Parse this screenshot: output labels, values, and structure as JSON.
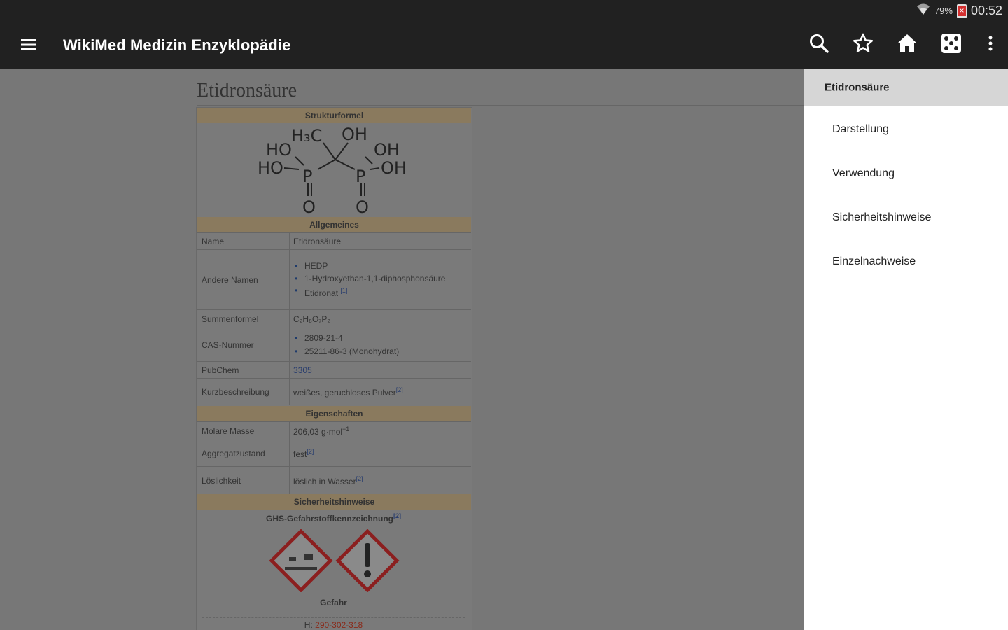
{
  "status_bar": {
    "battery_pct": "79%",
    "time": "00:52"
  },
  "app_bar": {
    "title": "WikiMed Medizin Enzyklopädie",
    "menu_icon": "hamburger-menu-icon",
    "actions": [
      {
        "name": "search",
        "icon": "search-icon"
      },
      {
        "name": "bookmark",
        "icon": "star-icon"
      },
      {
        "name": "home",
        "icon": "home-icon"
      },
      {
        "name": "random",
        "icon": "dice-icon"
      },
      {
        "name": "more",
        "icon": "more-vert-icon"
      }
    ]
  },
  "article": {
    "title": "Etidronsäure",
    "infobox": {
      "sections": {
        "structure": "Strukturformel",
        "general": "Allgemeines",
        "properties": "Eigenschaften",
        "safety": "Sicherheitshinweise"
      },
      "formula_atoms": {
        "h3c": "H₃C",
        "oh1": "OH",
        "ho": "HO",
        "oh2": "OH",
        "ho2": "HO",
        "p1": "P",
        "p2": "P",
        "oh3": "OH",
        "o1": "O",
        "o2": "O"
      },
      "rows": {
        "name_label": "Name",
        "name_value": "Etidronsäure",
        "other_names_label": "Andere Namen",
        "other_names": [
          "HEDP",
          "1-Hydroxyethan-1,1-diphosphonsäure",
          "Etidronat"
        ],
        "other_names_ref": "[1]",
        "formula_label": "Summenformel",
        "formula_value": "C₂H₈O₇P₂",
        "cas_label": "CAS-Nummer",
        "cas_values": [
          "2809-21-4",
          "25211-86-3 (Monohydrat)"
        ],
        "pubchem_label": "PubChem",
        "pubchem_value": "3305",
        "desc_label": "Kurzbeschreibung",
        "desc_value": "weißes, geruchloses Pulver",
        "desc_ref": "[2]",
        "molar_label": "Molare Masse",
        "molar_value": "206,03 g·mol",
        "molar_sup": "−1",
        "state_label": "Aggregatzustand",
        "state_value": "fest",
        "state_ref": "[2]",
        "solubility_label": "Löslichkeit",
        "solubility_value": "löslich in Wasser",
        "solubility_ref": "[2]",
        "ghs_label": "GHS-Gefahrstoffkennzeichnung",
        "ghs_ref": "[2]",
        "signal_word": "Gefahr",
        "h_prefix": "H:",
        "h_values": "290-302-318"
      }
    }
  },
  "toc": {
    "items": [
      {
        "label": "Etidronsäure",
        "active": true
      },
      {
        "label": "Darstellung",
        "active": false
      },
      {
        "label": "Verwendung",
        "active": false
      },
      {
        "label": "Sicherheitshinweise",
        "active": false
      },
      {
        "label": "Einzelnachweise",
        "active": false
      }
    ]
  }
}
